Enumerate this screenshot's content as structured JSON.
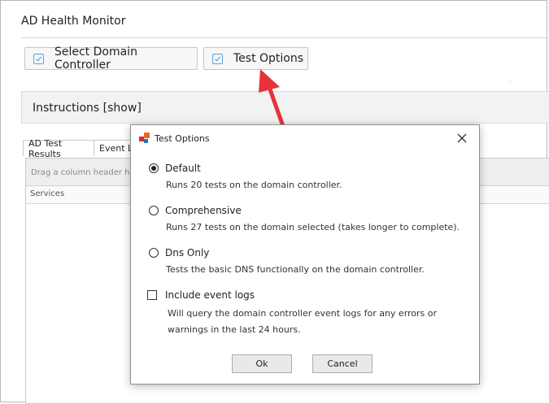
{
  "app": {
    "title": "AD Health Monitor"
  },
  "toolbar": {
    "select_dc_label": "Select Domain Controller",
    "test_options_label": "Test Options"
  },
  "instructions": {
    "label": "Instructions [show]"
  },
  "tabs": [
    {
      "label": "AD Test Results",
      "active": true
    },
    {
      "label": "Event Lo",
      "active": false
    }
  ],
  "grid": {
    "group_hint": "Drag a column header her",
    "columns": [
      "Services"
    ]
  },
  "dialog": {
    "title": "Test Options",
    "options": [
      {
        "label": "Default",
        "description": "Runs 20 tests on the domain controller.",
        "selected": true
      },
      {
        "label": "Comprehensive",
        "description": "Runs 27 tests on the domain selected (takes longer to complete).",
        "selected": false
      },
      {
        "label": "Dns Only",
        "description": "Tests the basic DNS functionally on the domain controller.",
        "selected": false
      }
    ],
    "event_logs": {
      "label": "Include event logs",
      "checked": false,
      "description_line1": "Will query the domain controller event logs for any errors or",
      "description_line2": "warnings in the last 24 hours."
    },
    "ok_label": "Ok",
    "cancel_label": "Cancel"
  },
  "colors": {
    "accent_blue": "#5aa0d8",
    "arrow_red": "#e8323a",
    "logo_orange": "#f26522",
    "logo_red": "#d62d20",
    "logo_blue": "#2f6fb6"
  },
  "icons": {
    "close": "close-icon",
    "checkbox": "check-icon",
    "app_logo": "app-logo-icon",
    "annotation": "red-arrow-annotation"
  }
}
